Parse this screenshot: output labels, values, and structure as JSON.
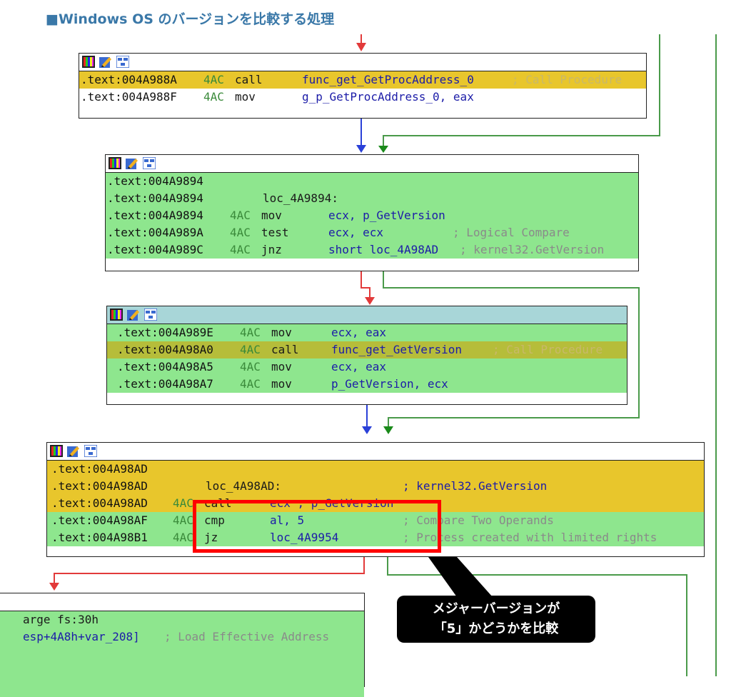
{
  "heading": "■Windows OS のバージョンを比較する処理",
  "colors": {
    "highlight_yellow": "#e8c62c",
    "block_green": "#8ee68e",
    "edge_red": "#e23a3a",
    "edge_green": "#3a9a3a",
    "edge_blue": "#2a40d8",
    "callout_bg": "#000000",
    "annotation_box": "#ff0000"
  },
  "toolbar_icons": [
    "color-palette-icon",
    "edit-pencil-icon",
    "graph-view-icon"
  ],
  "blocks": [
    {
      "lines": [
        {
          "addr": ".text:004A988A",
          "sp": "4AC",
          "mn": "call",
          "op": "func_get_GetProcAddress_0",
          "cm": "; Call Procedure",
          "bg": "y"
        },
        {
          "addr": ".text:004A988F",
          "sp": "4AC",
          "mn": "mov",
          "op": "g_p_GetProcAddress_0, eax",
          "cm": "",
          "bg": "w"
        }
      ]
    },
    {
      "lines": [
        {
          "addr": ".text:004A9894",
          "sp": "",
          "mn": "",
          "op": "",
          "cm": "",
          "bg": "g"
        },
        {
          "addr": ".text:004A9894",
          "sp": "",
          "mn": "loc_4A9894:",
          "op": "",
          "cm": "",
          "bg": "g"
        },
        {
          "addr": ".text:004A9894",
          "sp": "4AC",
          "mn": "mov",
          "op": "ecx, p_GetVersion",
          "cm": "",
          "bg": "g"
        },
        {
          "addr": ".text:004A989A",
          "sp": "4AC",
          "mn": "test",
          "op": "ecx, ecx",
          "cm": "; Logical Compare",
          "bg": "g"
        },
        {
          "addr": ".text:004A989C",
          "sp": "4AC",
          "mn": "jnz",
          "op": "short loc_4A98AD",
          "cm": "; kernel32.GetVersion",
          "bg": "g"
        }
      ]
    },
    {
      "lines": [
        {
          "addr": ".text:004A989E",
          "sp": "4AC",
          "mn": "mov",
          "op": "ecx, eax",
          "cm": "",
          "bg": "g"
        },
        {
          "addr": ".text:004A98A0",
          "sp": "4AC",
          "mn": "call",
          "op": "func_get_GetVersion",
          "cm": "; Call Procedure",
          "bg": "dy"
        },
        {
          "addr": ".text:004A98A5",
          "sp": "4AC",
          "mn": "mov",
          "op": "ecx, eax",
          "cm": "",
          "bg": "g"
        },
        {
          "addr": ".text:004A98A7",
          "sp": "4AC",
          "mn": "mov",
          "op": "p_GetVersion, ecx",
          "cm": "",
          "bg": "g"
        }
      ]
    },
    {
      "lines": [
        {
          "addr": ".text:004A98AD",
          "sp": "",
          "mn": "",
          "op": "",
          "cm": "",
          "bg": "y"
        },
        {
          "addr": ".text:004A98AD",
          "sp": "",
          "mn": "loc_4A98AD:",
          "op": "",
          "cm": "; kernel32.GetVersion",
          "bg": "y"
        },
        {
          "addr": ".text:004A98AD",
          "sp": "4AC",
          "mn": "call",
          "op": "ecx ; p_GetVersion",
          "cm": "",
          "bg": "y"
        },
        {
          "addr": ".text:004A98AF",
          "sp": "4AC",
          "mn": "cmp",
          "op": "al, 5",
          "cm": "; Compare Two Operands",
          "bg": "g"
        },
        {
          "addr": ".text:004A98B1",
          "sp": "4AC",
          "mn": "jz",
          "op": "loc_4A9954",
          "cm": "; Process created with limited rights",
          "bg": "g"
        }
      ]
    },
    {
      "lines": [
        {
          "addr": "",
          "sp": "",
          "mn": "",
          "op": "arge fs:30h",
          "cm": "",
          "bg": "g"
        },
        {
          "addr": "",
          "sp": "",
          "mn": "",
          "op": "esp+4A8h+var_208]",
          "cm": "; Load Effective Address",
          "bg": "g"
        }
      ]
    }
  ],
  "callout": {
    "line1": "メジャーバージョンが",
    "line2": "「5」かどうかを比較"
  }
}
